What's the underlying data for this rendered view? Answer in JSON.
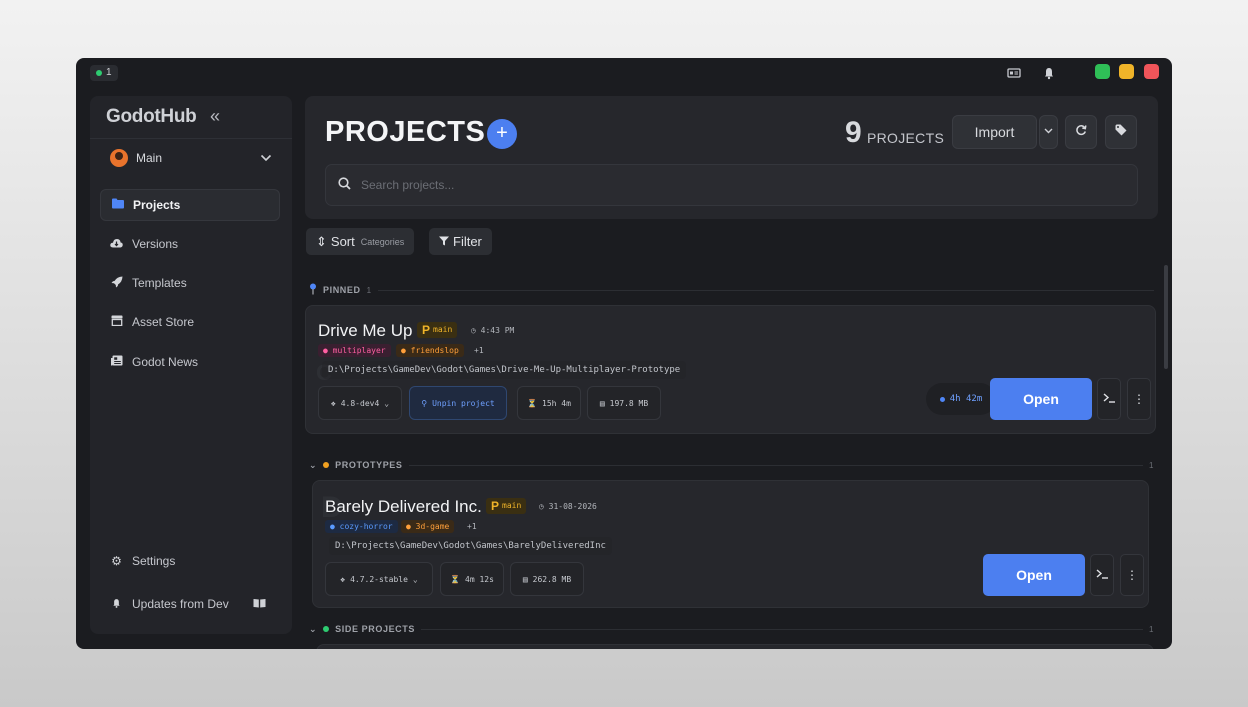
{
  "topbar": {
    "instance_count": "1",
    "icons": [
      "id-card-icon",
      "bell-icon"
    ],
    "window_buttons": [
      {
        "name": "maximize",
        "color": "#2fbf57"
      },
      {
        "name": "minimize",
        "color": "#f0b429"
      },
      {
        "name": "close",
        "color": "#f0555a"
      }
    ]
  },
  "sidebar": {
    "brand": "GodotHub",
    "collapse_glyph": "«",
    "profile": {
      "label": "Main"
    },
    "items": [
      {
        "label": "Projects",
        "icon": "folder-icon",
        "active": true
      },
      {
        "label": "Versions",
        "icon": "cloud-download-icon",
        "active": false
      },
      {
        "label": "Templates",
        "icon": "rocket-icon",
        "active": false
      },
      {
        "label": "Asset Store",
        "icon": "store-icon",
        "active": false
      },
      {
        "label": "Godot News",
        "icon": "newspaper-icon",
        "active": false
      }
    ],
    "footer": [
      {
        "label": "Settings",
        "icon": "gear-icon"
      },
      {
        "label": "Updates from Dev",
        "icon": "bell-icon"
      }
    ]
  },
  "header": {
    "title": "PROJECTS",
    "project_count": "9",
    "project_count_label": "PROJECTS",
    "import_label": "Import"
  },
  "search": {
    "placeholder": "Search projects..."
  },
  "toolbar": {
    "sort_label": "Sort",
    "sort_sub": "Categories",
    "filter_label": "Filter"
  },
  "sections": {
    "pinned": {
      "label": "PINNED",
      "count": "1"
    },
    "prototypes": {
      "label": "PROTOTYPES",
      "count": "1",
      "color": "#f0a020"
    },
    "side_projects": {
      "label": "SIDE PROJECTS",
      "count": "1",
      "color": "#2ecc71"
    }
  },
  "projects": [
    {
      "title": "Drive Me Up",
      "branch": "main",
      "time": "4:43 PM",
      "tags": [
        {
          "label": "multiplayer",
          "color": "pink"
        },
        {
          "label": "friendslop",
          "color": "orange"
        }
      ],
      "more_tags": "+1",
      "path": "D:\\Projects\\GameDev\\Godot\\Games\\Drive-Me-Up-Multiplayer-Prototype",
      "engine": "4.8-dev4",
      "unpin_label": "Unpin project",
      "playtime": "15h 4m",
      "size": "197.8 MB",
      "session": "4h 42m",
      "open_label": "Open"
    },
    {
      "title": "Barely Delivered Inc.",
      "branch": "main",
      "time": "31-08-2026",
      "tags": [
        {
          "label": "cozy-horror",
          "color": "blue"
        },
        {
          "label": "3d-game",
          "color": "orange"
        }
      ],
      "more_tags": "+1",
      "path": "D:\\Projects\\GameDev\\Godot\\Games\\BarelyDeliveredInc",
      "engine": "4.7.2-stable",
      "playtime": "4m 12s",
      "size": "262.8 MB",
      "open_label": "Open"
    }
  ]
}
